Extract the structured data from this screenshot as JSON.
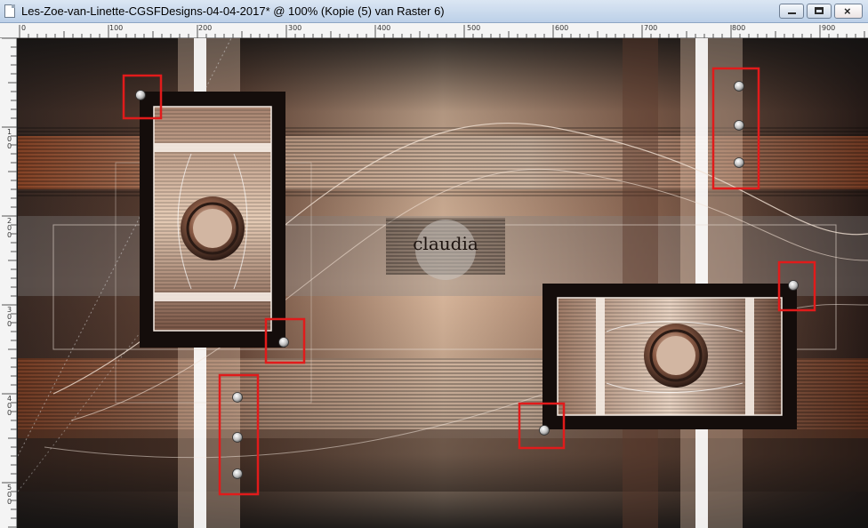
{
  "window": {
    "title": "Les-Zoe-van-Linette-CGSFDesigns-04-04-2017* @ 100% (Kopie (5) van Raster 6)",
    "buttons": {
      "minimize": "minimize",
      "maximize": "maximize",
      "close": "×"
    }
  },
  "ruler_top": {
    "labels": [
      "0",
      "100",
      "200",
      "300",
      "400",
      "500",
      "600",
      "700",
      "800",
      "900"
    ]
  },
  "ruler_left": {
    "labels": [
      "1\n0\n0",
      "2\n0\n0",
      "3\n0\n0",
      "4\n0\n0",
      "5\n0\n0"
    ]
  },
  "canvas": {
    "watermark": "claudia"
  },
  "colors": {
    "highlight": "#e11b1b",
    "titlebar": "#c9d8ec"
  }
}
